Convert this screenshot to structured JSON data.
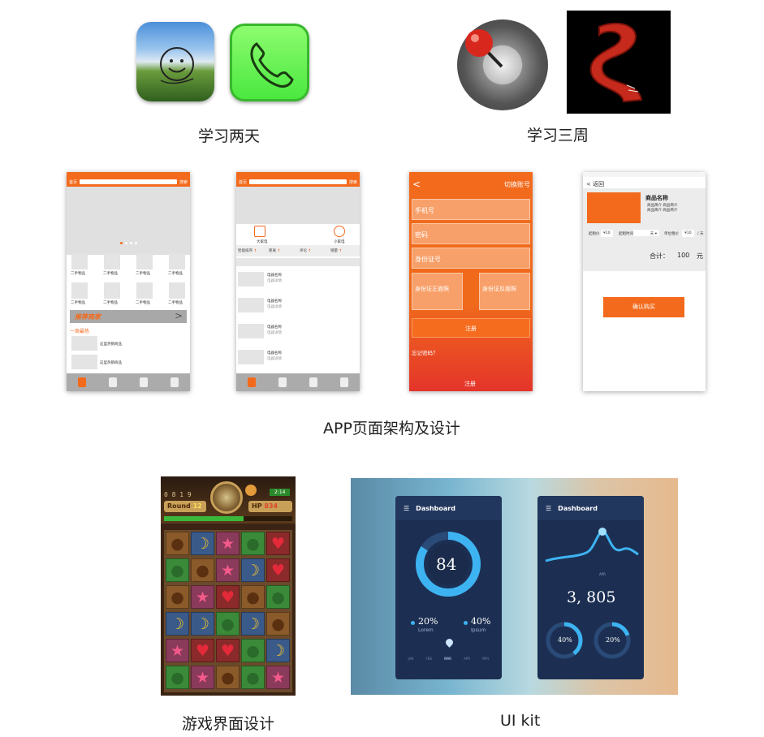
{
  "captions": {
    "two_days": "学习两天",
    "three_weeks": "学习三周",
    "app_design": "APP页面架构及设计",
    "game_ui": "游戏界面设计",
    "ui_kit": "UI kit"
  },
  "app_screens": {
    "home": {
      "category": "首页",
      "search_btn": "搜索",
      "grid_label": "二手物品",
      "recommend": "推荐商家",
      "hot": "一周最热",
      "hot_item": "这里热销商品"
    },
    "list": {
      "category": "首页",
      "search_btn": "搜索",
      "left_icon_label": "大家电",
      "right_icon_label": "小家电",
      "filters": [
        "智能排序",
        "距离",
        "评论",
        "销量"
      ],
      "item_name": "电器名称",
      "item_desc": "电器详情"
    },
    "register": {
      "switch_account": "切换账号",
      "fields": [
        "手机号",
        "密码",
        "身份证号"
      ],
      "id_front": "身份证正面照",
      "id_back": "身份证反面照",
      "register_btn": "注册",
      "forgot": "忘记密码？",
      "bottom_register": "注册"
    },
    "product": {
      "back": "< 返回",
      "product_name": "商品名称",
      "intro_lines": [
        "商品简介  商品简介",
        "商品简介  商品简介"
      ],
      "start_price_label": "起租价",
      "start_price": "¥10",
      "start_time_label": "起租时间",
      "unit": "天",
      "unit_price_label": "单位租价",
      "unit_price": "¥10",
      "per": "/ 天",
      "total_label": "合计：",
      "total_value": "100",
      "total_unit": "元",
      "confirm_btn": "确认购买"
    }
  },
  "game": {
    "round_label": "Round",
    "round_value": "12",
    "hp_label": "HP",
    "hp_value": "834",
    "timer": "2:14",
    "digits": "0 8 1 9"
  },
  "dashboard": {
    "title": "Dashboard",
    "ring_value": "84",
    "stat1_value": "20%",
    "stat1_label": "Lorem",
    "stat2_value": "40%",
    "stat2_label": "Ipsum",
    "x_labels": [
      "JAN",
      "FEB",
      "MAR",
      "APR",
      "MAY"
    ],
    "big_number": "3, 805",
    "gauge1": "40%",
    "gauge2": "20%",
    "chart_month": "APR"
  },
  "colors": {
    "accent_orange": "#f36a1c",
    "dash_navy": "#1c2f52",
    "dash_blue": "#3db3f2"
  }
}
